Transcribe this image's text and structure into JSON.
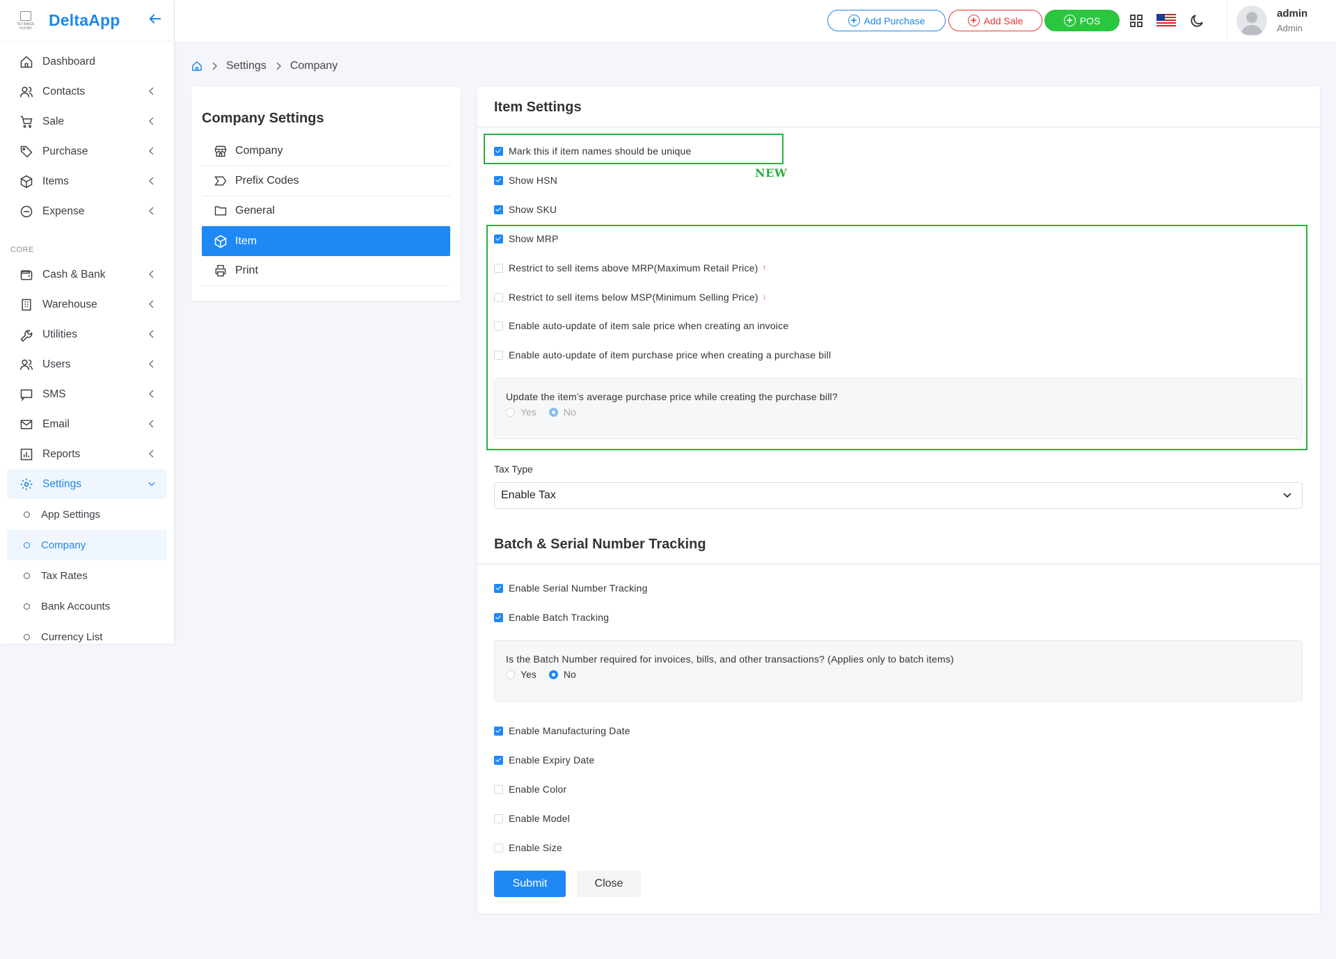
{
  "brand": {
    "name": "DeltaApp",
    "logo_text": "NO IMAGE FOUND"
  },
  "sidebar": {
    "items": [
      {
        "label": "Dashboard",
        "icon": "home-icon",
        "chevron": false
      },
      {
        "label": "Contacts",
        "icon": "users-icon",
        "chevron": true
      },
      {
        "label": "Sale",
        "icon": "cart-icon",
        "chevron": true
      },
      {
        "label": "Purchase",
        "icon": "tag-icon",
        "chevron": true
      },
      {
        "label": "Items",
        "icon": "box-icon",
        "chevron": true
      },
      {
        "label": "Expense",
        "icon": "minus-circle-icon",
        "chevron": true
      }
    ],
    "section": "CORE",
    "core_items": [
      {
        "label": "Cash & Bank",
        "icon": "wallet-icon"
      },
      {
        "label": "Warehouse",
        "icon": "building-icon"
      },
      {
        "label": "Utilities",
        "icon": "wrench-icon"
      },
      {
        "label": "Users",
        "icon": "users-icon"
      },
      {
        "label": "SMS",
        "icon": "message-icon"
      },
      {
        "label": "Email",
        "icon": "mail-icon"
      },
      {
        "label": "Reports",
        "icon": "chart-icon"
      }
    ],
    "settings": {
      "label": "Settings",
      "icon": "gear-icon"
    },
    "sub_items": [
      "App Settings",
      "Company",
      "Tax Rates",
      "Bank Accounts",
      "Currency List"
    ]
  },
  "topbar": {
    "add_purchase": "Add Purchase",
    "add_sale": "Add Sale",
    "pos": "POS",
    "user_name": "admin",
    "user_role": "Admin"
  },
  "breadcrumb": {
    "level1": "Settings",
    "level2": "Company"
  },
  "company_settings": {
    "title": "Company Settings",
    "items": [
      "Company",
      "Prefix Codes",
      "General",
      "Item",
      "Print"
    ]
  },
  "item_settings": {
    "title": "Item Settings",
    "new_label": "NEW",
    "unique_names": "Mark this if item names should be unique",
    "show_hsn": "Show HSN",
    "show_sku": "Show SKU",
    "show_mrp": "Show MRP",
    "restrict_above_mrp": "Restrict to sell items above MRP(Maximum Retail Price)",
    "restrict_below_msp": "Restrict to sell items below MSP(Minimum Selling Price)",
    "auto_sale_price": "Enable auto-update of item sale price when creating an invoice",
    "auto_purchase_price": "Enable auto-update of item purchase price when creating a purchase bill",
    "avg_question": "Update the item’s average purchase price while creating the purchase bill?",
    "yes": "Yes",
    "no": "No",
    "tax_type_label": "Tax Type",
    "tax_type_value": "Enable Tax"
  },
  "batch": {
    "title": "Batch & Serial Number Tracking",
    "serial": "Enable Serial Number Tracking",
    "batch_tracking": "Enable Batch Tracking",
    "question": "Is the Batch Number required for invoices, bills, and other transactions? (Applies only to batch items)",
    "yes": "Yes",
    "no": "No",
    "mfg_date": "Enable Manufacturing Date",
    "expiry_date": "Enable Expiry Date",
    "color": "Enable Color",
    "model": "Enable Model",
    "size": "Enable Size"
  },
  "actions": {
    "submit": "Submit",
    "close": "Close"
  }
}
